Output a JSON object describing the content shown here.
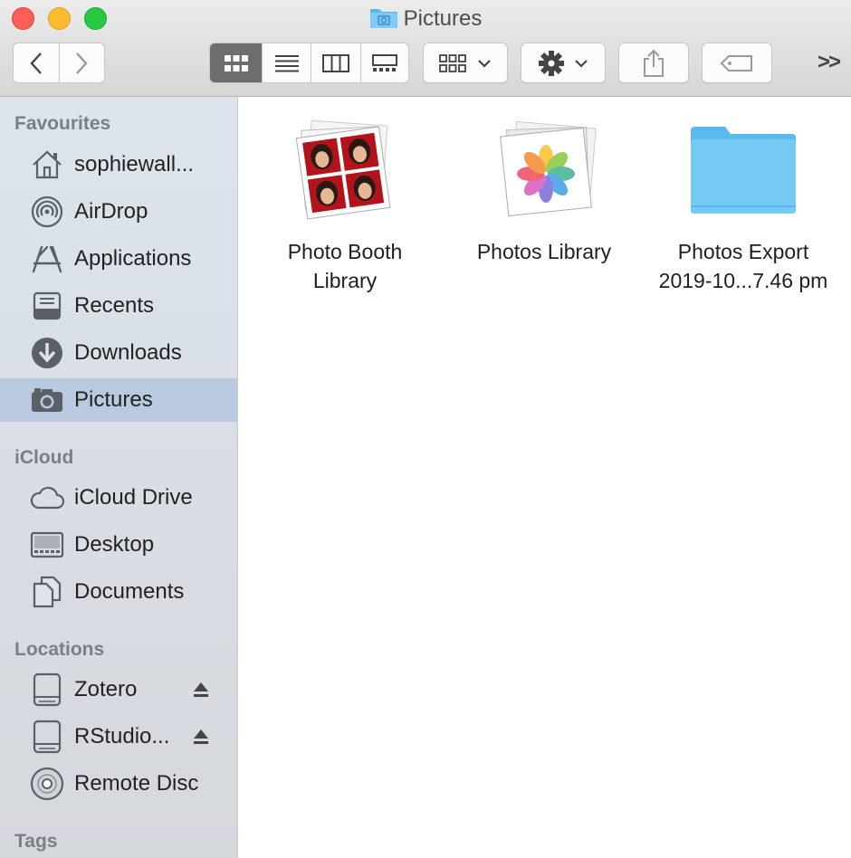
{
  "window": {
    "title": "Pictures"
  },
  "toolbar": {
    "back_icon": "chevron-left-icon",
    "forward_icon": "chevron-right-icon",
    "view_modes": [
      "icon-view-icon",
      "list-view-icon",
      "column-view-icon",
      "gallery-view-icon"
    ],
    "active_view": "icon-view-icon",
    "group_icon": "group-by-icon",
    "action_icon": "gear-icon",
    "share_icon": "share-icon",
    "tag_icon": "tag-icon",
    "overflow_label": ">>"
  },
  "sidebar": {
    "favourites_header": "Favourites",
    "favourites": [
      {
        "label": "sophiewall...",
        "icon": "home-icon"
      },
      {
        "label": "AirDrop",
        "icon": "airdrop-icon"
      },
      {
        "label": "Applications",
        "icon": "applications-icon"
      },
      {
        "label": "Recents",
        "icon": "recents-icon"
      },
      {
        "label": "Downloads",
        "icon": "downloads-icon"
      },
      {
        "label": "Pictures",
        "icon": "camera-icon",
        "selected": true
      }
    ],
    "icloud_header": "iCloud",
    "icloud": [
      {
        "label": "iCloud Drive",
        "icon": "cloud-icon"
      },
      {
        "label": "Desktop",
        "icon": "desktop-icon"
      },
      {
        "label": "Documents",
        "icon": "documents-icon"
      }
    ],
    "locations_header": "Locations",
    "locations": [
      {
        "label": "Zotero",
        "icon": "drive-icon",
        "ejectable": true
      },
      {
        "label": "RStudio...",
        "icon": "drive-icon",
        "ejectable": true
      },
      {
        "label": "Remote Disc",
        "icon": "disc-icon"
      }
    ],
    "tags_header": "Tags"
  },
  "files": [
    {
      "line1": "Photo Booth",
      "line2": "Library",
      "icon": "photo-booth-library-icon"
    },
    {
      "line1": "Photos Library",
      "line2": "",
      "icon": "photos-library-icon"
    },
    {
      "line1": "Photos Export",
      "line2": "2019-10...7.46 pm",
      "icon": "folder-icon"
    }
  ],
  "colors": {
    "selection": "#b8c9e0",
    "folder": "#6cc4f5",
    "close": "#fc5f57",
    "minimize": "#fdbc2e",
    "maximize": "#28c840"
  }
}
